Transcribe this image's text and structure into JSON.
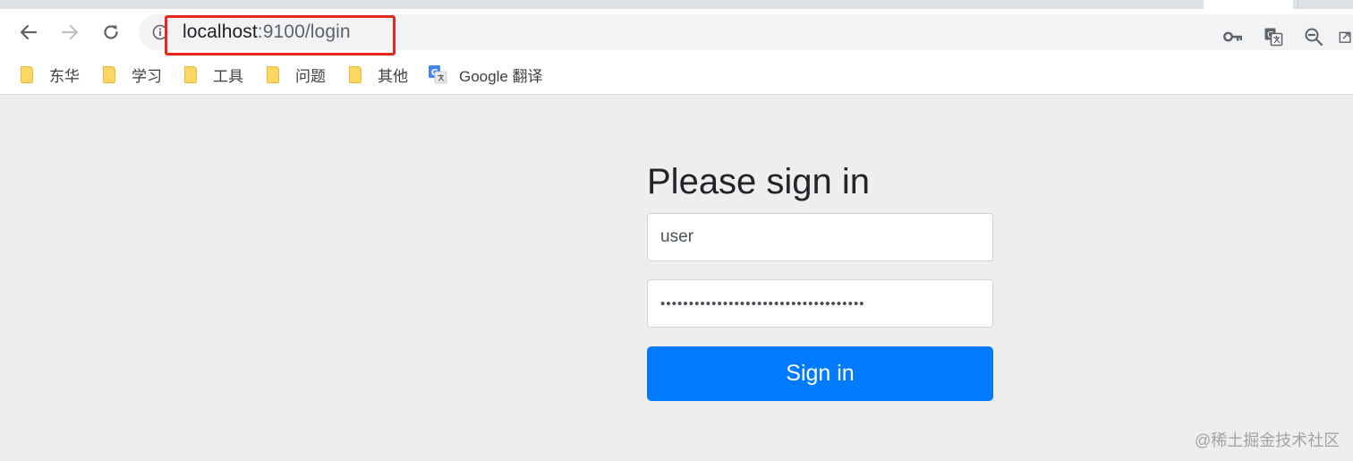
{
  "browser": {
    "url_host": "localhost",
    "url_path": ":9100/login",
    "bookmarks": [
      {
        "label": "东华",
        "icon": "folder-icon"
      },
      {
        "label": "学习",
        "icon": "folder-icon"
      },
      {
        "label": "工具",
        "icon": "folder-icon"
      },
      {
        "label": "问题",
        "icon": "folder-icon"
      },
      {
        "label": "其他",
        "icon": "folder-icon"
      },
      {
        "label": "Google 翻译",
        "icon": "google-translate-icon"
      }
    ],
    "highlight_color": "#e8271f"
  },
  "login": {
    "heading": "Please sign in",
    "username_value": "user",
    "password_mask": "••••••••••••••••••••••••••••••••••••",
    "submit_label": "Sign in",
    "button_color": "#007bff"
  },
  "watermark": "@稀土掘金技术社区"
}
